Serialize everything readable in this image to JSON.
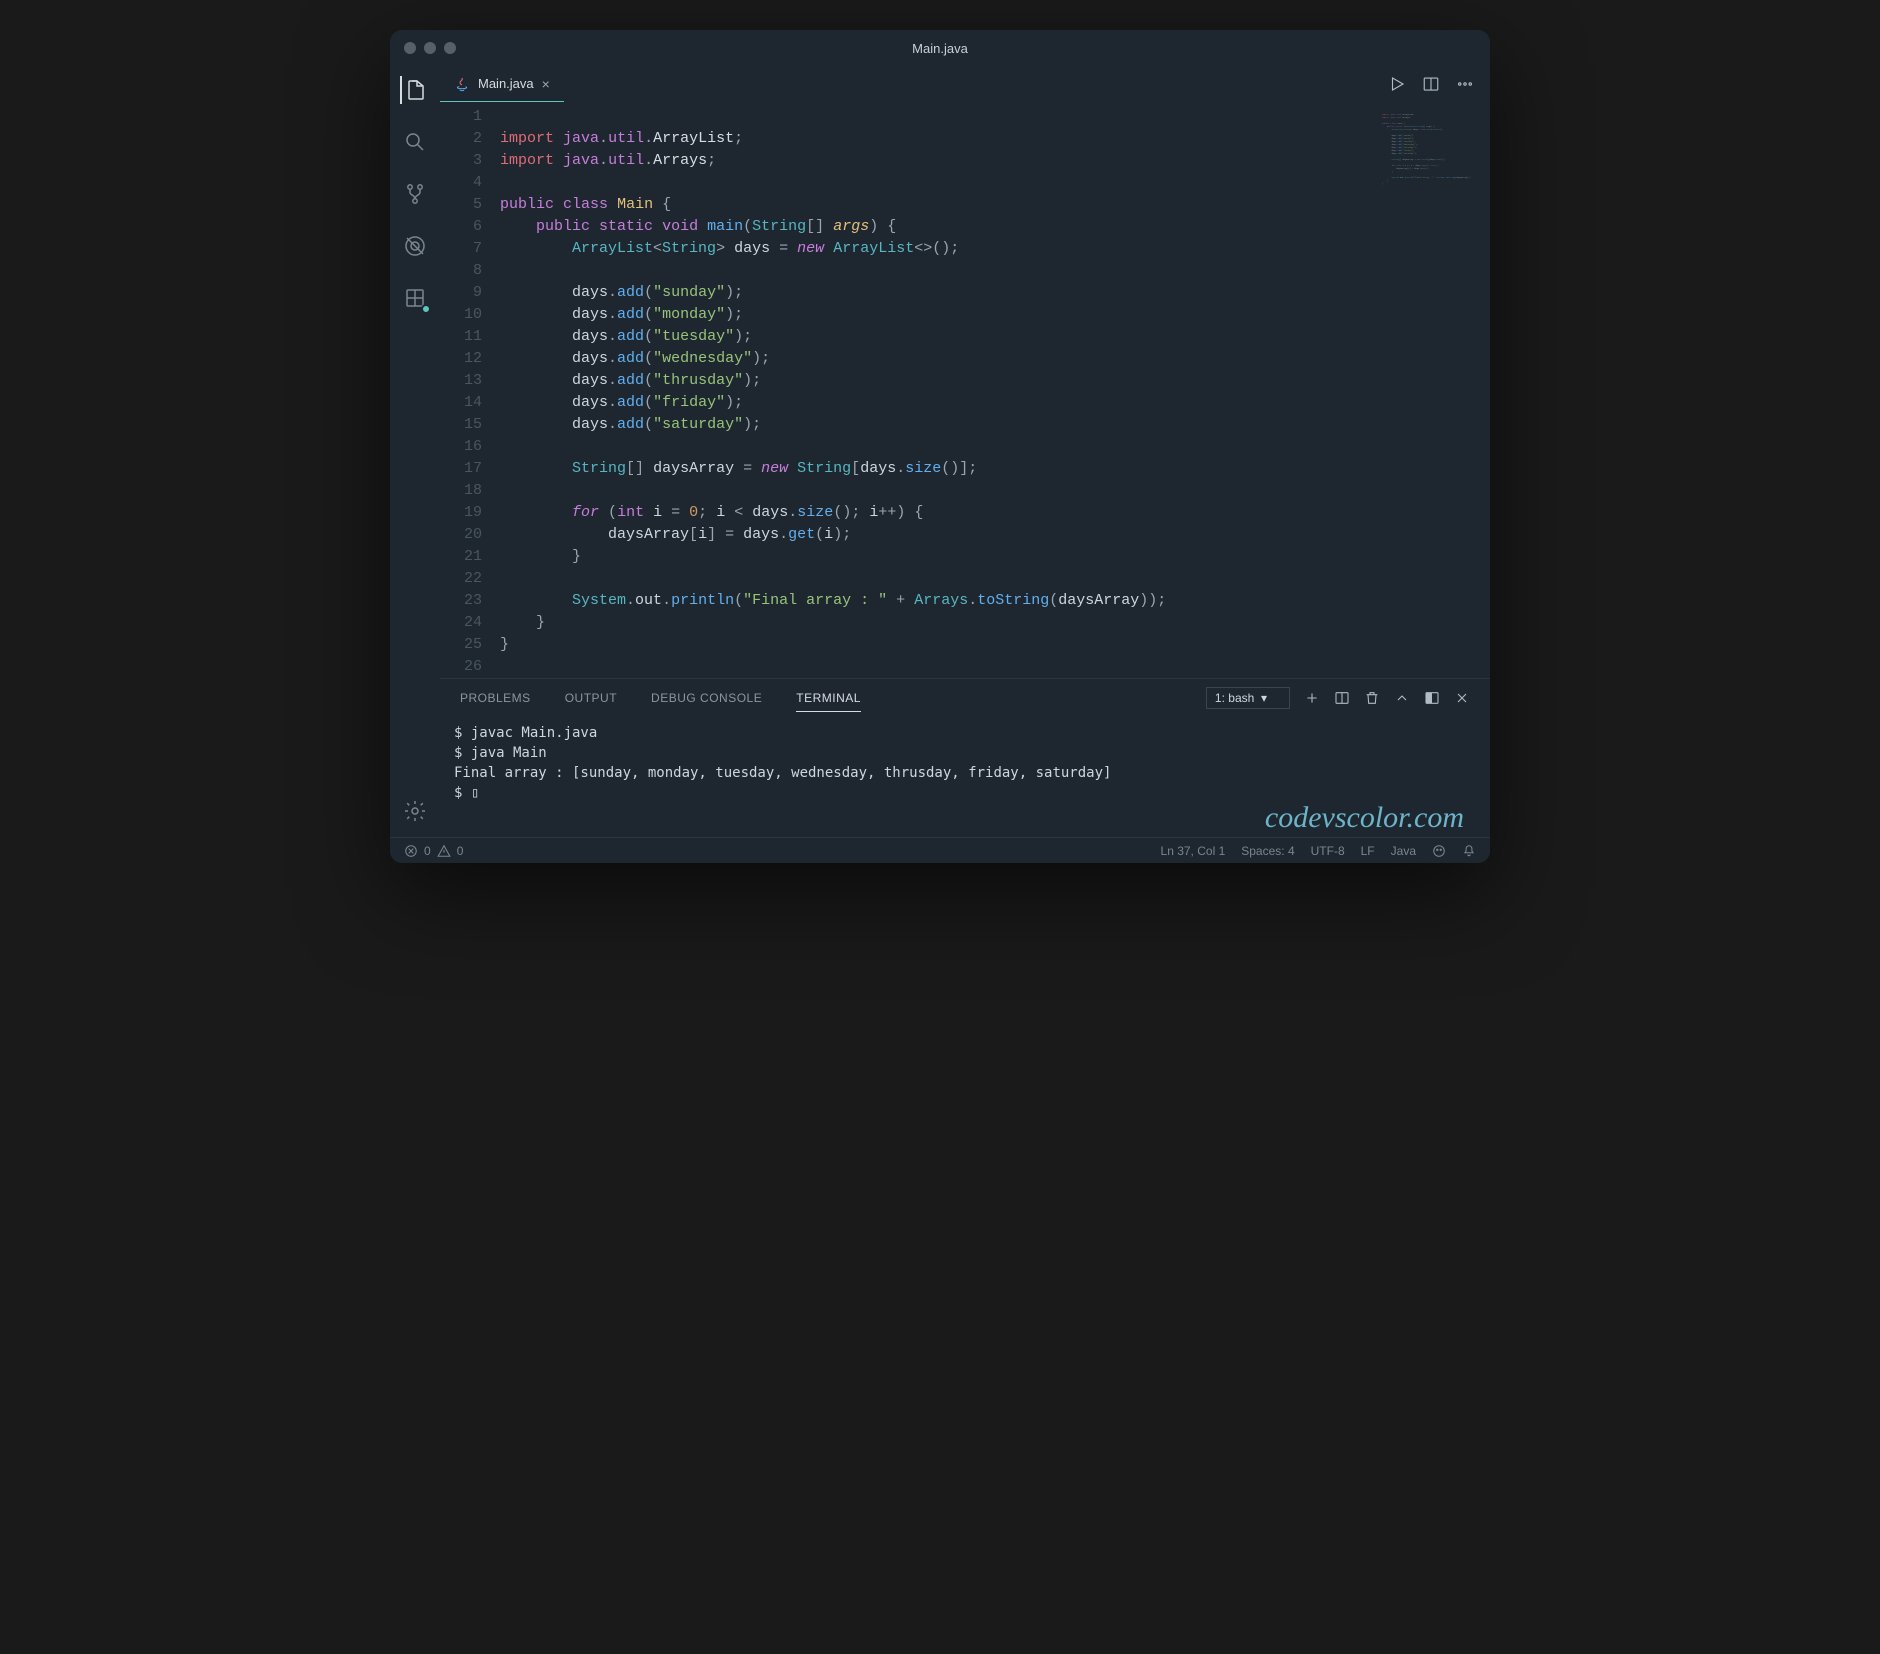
{
  "title": "Main.java",
  "tab": {
    "filename": "Main.java"
  },
  "code_lines": [
    {
      "n": 1,
      "html": ""
    },
    {
      "n": 2,
      "html": "<span class='kw-import'>import</span> <span class='kw-pkg'>java</span><span class='punct'>.</span><span class='kw-pkg'>util</span><span class='punct'>.</span><span class='kw-id'>ArrayList</span><span class='punct'>;</span>"
    },
    {
      "n": 3,
      "html": "<span class='kw-import'>import</span> <span class='kw-pkg'>java</span><span class='punct'>.</span><span class='kw-pkg'>util</span><span class='punct'>.</span><span class='kw-id'>Arrays</span><span class='punct'>;</span>"
    },
    {
      "n": 4,
      "html": ""
    },
    {
      "n": 5,
      "html": "<span class='kw-blue'>public</span> <span class='kw-blue'>class</span> <span class='kw-class'>Main</span> <span class='punct'>{</span>"
    },
    {
      "n": 6,
      "html": "    <span class='kw-blue'>public</span> <span class='kw-blue'>static</span> <span class='kw-blue'>void</span> <span class='kw-func'>main</span><span class='punct'>(</span><span class='kw-type'>String</span><span class='punct'>[]</span> <span class='kw-param'>args</span><span class='punct'>) {</span>"
    },
    {
      "n": 7,
      "html": "        <span class='kw-type'>ArrayList</span><span class='punct'>&lt;</span><span class='kw-type'>String</span><span class='punct'>&gt;</span> <span class='kw-var'>days</span> <span class='punct'>=</span> <span class='kw-italic'>new</span> <span class='kw-type'>ArrayList</span><span class='punct'>&lt;&gt;();</span>"
    },
    {
      "n": 8,
      "html": ""
    },
    {
      "n": 9,
      "html": "        <span class='kw-var'>days</span><span class='punct'>.</span><span class='method'>add</span><span class='punct'>(</span><span class='str'>\"sunday\"</span><span class='punct'>);</span>"
    },
    {
      "n": 10,
      "html": "        <span class='kw-var'>days</span><span class='punct'>.</span><span class='method'>add</span><span class='punct'>(</span><span class='str'>\"monday\"</span><span class='punct'>);</span>"
    },
    {
      "n": 11,
      "html": "        <span class='kw-var'>days</span><span class='punct'>.</span><span class='method'>add</span><span class='punct'>(</span><span class='str'>\"tuesday\"</span><span class='punct'>);</span>"
    },
    {
      "n": 12,
      "html": "        <span class='kw-var'>days</span><span class='punct'>.</span><span class='method'>add</span><span class='punct'>(</span><span class='str'>\"wednesday\"</span><span class='punct'>);</span>"
    },
    {
      "n": 13,
      "html": "        <span class='kw-var'>days</span><span class='punct'>.</span><span class='method'>add</span><span class='punct'>(</span><span class='str'>\"thrusday\"</span><span class='punct'>);</span>"
    },
    {
      "n": 14,
      "html": "        <span class='kw-var'>days</span><span class='punct'>.</span><span class='method'>add</span><span class='punct'>(</span><span class='str'>\"friday\"</span><span class='punct'>);</span>"
    },
    {
      "n": 15,
      "html": "        <span class='kw-var'>days</span><span class='punct'>.</span><span class='method'>add</span><span class='punct'>(</span><span class='str'>\"saturday\"</span><span class='punct'>);</span>"
    },
    {
      "n": 16,
      "html": ""
    },
    {
      "n": 17,
      "html": "        <span class='kw-type'>String</span><span class='punct'>[]</span> <span class='kw-var'>daysArray</span> <span class='punct'>=</span> <span class='kw-italic'>new</span> <span class='kw-type'>String</span><span class='punct'>[</span><span class='kw-var'>days</span><span class='punct'>.</span><span class='method'>size</span><span class='punct'>()];</span>"
    },
    {
      "n": 18,
      "html": ""
    },
    {
      "n": 19,
      "html": "        <span class='kw-italic'>for</span> <span class='punct'>(</span><span class='kw-blue'>int</span> <span class='kw-var'>i</span> <span class='punct'>=</span> <span class='num'>0</span><span class='punct'>;</span> <span class='kw-var'>i</span> <span class='punct'>&lt;</span> <span class='kw-var'>days</span><span class='punct'>.</span><span class='method'>size</span><span class='punct'>();</span> <span class='kw-var'>i</span><span class='punct'>++) {</span>"
    },
    {
      "n": 20,
      "html": "            <span class='kw-var'>daysArray</span><span class='punct'>[</span><span class='kw-var'>i</span><span class='punct'>] =</span> <span class='kw-var'>days</span><span class='punct'>.</span><span class='method'>get</span><span class='punct'>(</span><span class='kw-var'>i</span><span class='punct'>);</span>"
    },
    {
      "n": 21,
      "html": "        <span class='punct'>}</span>"
    },
    {
      "n": 22,
      "html": ""
    },
    {
      "n": 23,
      "html": "        <span class='kw-type'>System</span><span class='punct'>.</span><span class='kw-var'>out</span><span class='punct'>.</span><span class='method'>println</span><span class='punct'>(</span><span class='str'>\"Final array : \"</span> <span class='punct'>+</span> <span class='kw-type'>Arrays</span><span class='punct'>.</span><span class='method'>toString</span><span class='punct'>(</span><span class='kw-var'>daysArray</span><span class='punct'>));</span>"
    },
    {
      "n": 24,
      "html": "    <span class='punct'>}</span>"
    },
    {
      "n": 25,
      "html": "<span class='punct'>}</span>"
    },
    {
      "n": 26,
      "html": ""
    }
  ],
  "panel_tabs": {
    "problems": "PROBLEMS",
    "output": "OUTPUT",
    "debug": "DEBUG CONSOLE",
    "terminal": "TERMINAL"
  },
  "terminal_select": "1: bash",
  "terminal_lines": [
    "$ javac Main.java",
    "$ java Main",
    "Final array : [sunday, monday, tuesday, wednesday, thrusday, friday, saturday]",
    "$ ▯"
  ],
  "watermark": "codevscolor.com",
  "status": {
    "errors": "0",
    "warnings": "0",
    "position": "Ln 37, Col 1",
    "spaces": "Spaces: 4",
    "encoding": "UTF-8",
    "eol": "LF",
    "lang": "Java"
  }
}
